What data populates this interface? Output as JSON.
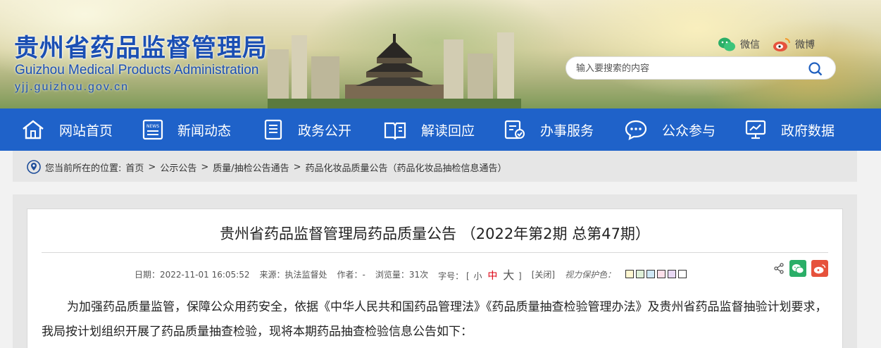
{
  "header": {
    "site_title": "贵州省药品监督管理局",
    "site_title_en": "Guizhou Medical Products Administration",
    "site_url": "yjj.guizhou.gov.cn",
    "social": {
      "wechat_label": "微信",
      "weibo_label": "微博"
    },
    "search": {
      "placeholder": "输入要搜索的内容",
      "icon": "search-icon"
    }
  },
  "nav": {
    "items": [
      {
        "label": "网站首页",
        "icon": "home-icon"
      },
      {
        "label": "新闻动态",
        "icon": "newspaper-icon"
      },
      {
        "label": "政务公开",
        "icon": "document-list-icon"
      },
      {
        "label": "解读回应",
        "icon": "open-book-icon"
      },
      {
        "label": "办事服务",
        "icon": "service-form-icon"
      },
      {
        "label": "公众参与",
        "icon": "chat-bubble-icon"
      },
      {
        "label": "政府数据",
        "icon": "data-screen-icon"
      }
    ]
  },
  "breadcrumb": {
    "prefix": "您当前所在的位置:",
    "items": [
      "首页",
      "公示公告",
      "质量/抽检公告通告",
      "药品化妆品质量公告（药品化妆品抽检信息通告）"
    ],
    "separator": ">"
  },
  "article": {
    "title": "贵州省药品监督管理局药品质量公告 （2022年第2期 总第47期）",
    "meta": {
      "date_label": "日期：",
      "date": "2022-11-01 16:05:52",
      "source_label": "来源：",
      "source": "执法监督处",
      "author_label": "作者：",
      "author": "-",
      "views_label": "浏览量：",
      "views": "31次",
      "font_size_label": "字号：",
      "bracket_open": "[",
      "bracket_close": "]",
      "size_small": "小",
      "size_medium": "中",
      "size_large": "大",
      "close": "[关闭]",
      "eye_protect": "视力保护色："
    },
    "eye_colors": [
      "#fff7d1",
      "#dff0d8",
      "#cfe8f6",
      "#fde0ea",
      "#e8d8f4",
      "#ffffff"
    ],
    "body": "为加强药品质量监管，保障公众用药安全，依据《中华人民共和国药品管理法》《药品质量抽查检验管理办法》及贵州省药品监督抽验计划要求，我局按计划组织开展了药品质量抽查检验，现将本期药品抽查检验信息公告如下："
  },
  "colors": {
    "nav_bg": "#1f62c9",
    "title_blue": "#1b4fb3",
    "wechat_green": "#2aae67",
    "weibo_red": "#e6523c"
  }
}
